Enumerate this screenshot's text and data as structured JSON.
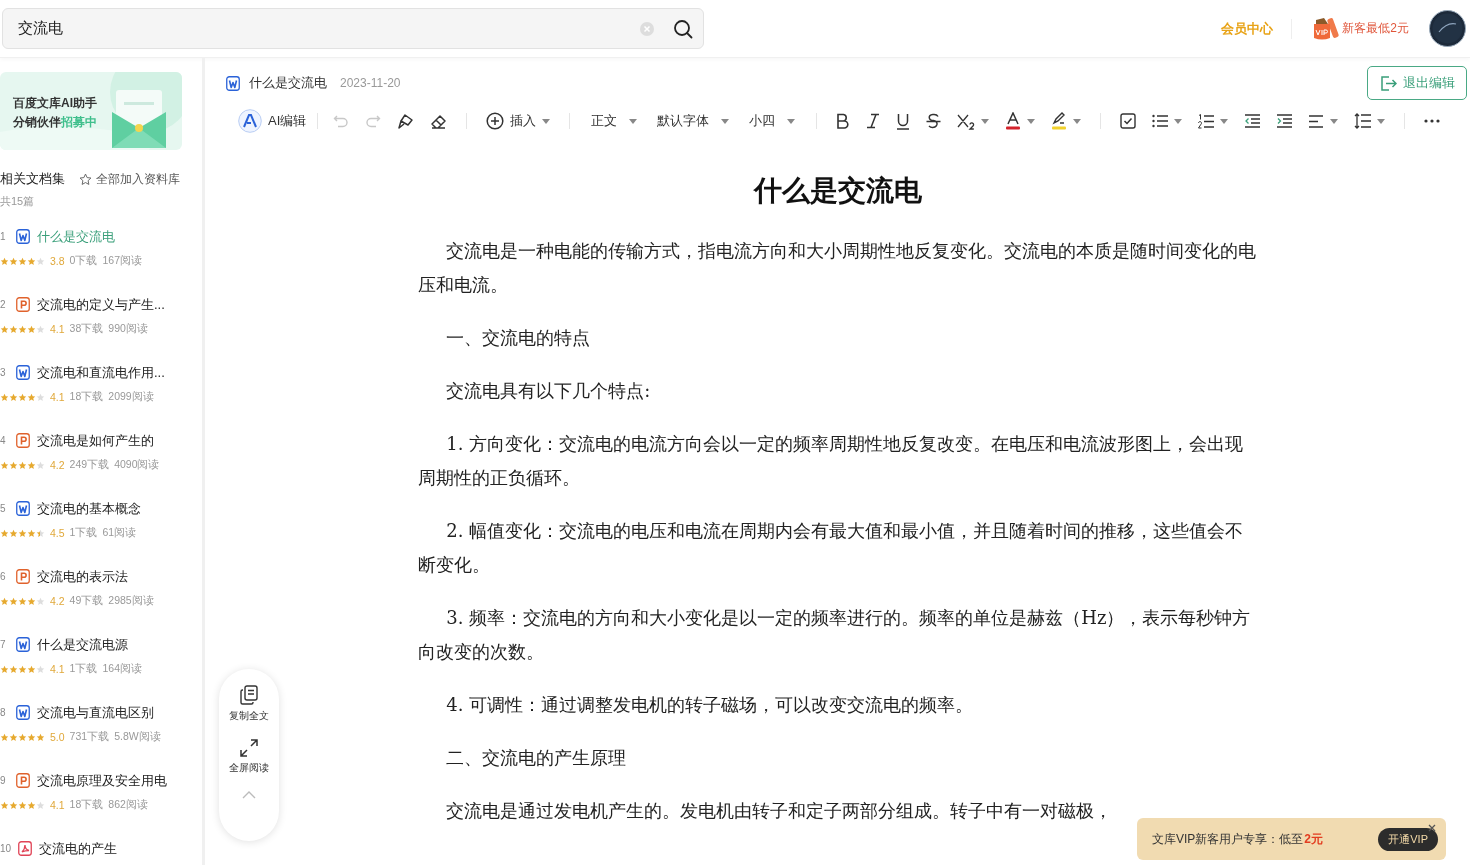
{
  "search": {
    "value": "交流电"
  },
  "header": {
    "member_center": "会员中心",
    "promo": "新客最低2元"
  },
  "sidebar": {
    "banner": {
      "line1": "百度文库AI助手",
      "line2": "分销伙伴",
      "line2_highlight": "招募中"
    },
    "collection": {
      "title": "相关文档集",
      "add_all": "全部加入资料库",
      "count": "共15篇"
    },
    "documents": [
      {
        "index": "1",
        "kind": "word",
        "title": "什么是交流电",
        "selected": true,
        "stars": 4,
        "rating": "3.8",
        "downloads": "0下载",
        "reads": "167阅读"
      },
      {
        "index": "2",
        "kind": "ppt",
        "title": "交流电的定义与产生...",
        "selected": false,
        "stars": 4,
        "rating": "4.1",
        "downloads": "38下载",
        "reads": "990阅读"
      },
      {
        "index": "3",
        "kind": "word",
        "title": "交流电和直流电作用...",
        "selected": false,
        "stars": 4,
        "rating": "4.1",
        "downloads": "18下载",
        "reads": "2099阅读"
      },
      {
        "index": "4",
        "kind": "ppt",
        "title": "交流电是如何产生的",
        "selected": false,
        "stars": 4,
        "rating": "4.2",
        "downloads": "249下载",
        "reads": "4090阅读"
      },
      {
        "index": "5",
        "kind": "word",
        "title": "交流电的基本概念",
        "selected": false,
        "stars": 4.5,
        "rating": "4.5",
        "downloads": "1下载",
        "reads": "61阅读"
      },
      {
        "index": "6",
        "kind": "ppt",
        "title": "交流电的表示法",
        "selected": false,
        "stars": 4,
        "rating": "4.2",
        "downloads": "49下载",
        "reads": "2985阅读"
      },
      {
        "index": "7",
        "kind": "word",
        "title": "什么是交流电源",
        "selected": false,
        "stars": 4,
        "rating": "4.1",
        "downloads": "1下载",
        "reads": "164阅读"
      },
      {
        "index": "8",
        "kind": "word",
        "title": "交流电与直流电区别",
        "selected": false,
        "stars": 5,
        "rating": "5.0",
        "downloads": "731下载",
        "reads": "5.8W阅读"
      },
      {
        "index": "9",
        "kind": "ppt",
        "title": "交流电原理及安全用电",
        "selected": false,
        "stars": 4,
        "rating": "4.1",
        "downloads": "18下载",
        "reads": "862阅读"
      },
      {
        "index": "10",
        "kind": "pdf",
        "title": "交流电的产生",
        "selected": false
      }
    ]
  },
  "document": {
    "title": "什么是交流电",
    "date": "2023-11-20",
    "exit_edit": "退出编辑",
    "toolbar": {
      "ai_edit": "AI编辑",
      "undo": {
        "disabled": true
      },
      "redo": {
        "disabled": true
      },
      "insert": "插入",
      "style": "正文",
      "font": "默认字体",
      "size": "小四"
    },
    "heading": "什么是交流电",
    "paragraphs": [
      "交流电是一种电能的传输方式，指电流方向和大小周期性地反复变化。交流电的本质是随时间变化的电压和电流。",
      "一、交流电的特点",
      "交流电具有以下几个特点:",
      "1. 方向变化：交流电的电流方向会以一定的频率周期性地反复改变。在电压和电流波形图上，会出现周期性的正负循环。",
      "2. 幅值变化：交流电的电压和电流在周期内会有最大值和最小值，并且随着时间的推移，这些值会不断变化。",
      "3. 频率：交流电的方向和大小变化是以一定的频率进行的。频率的单位是赫兹（Hz），表示每秒钟方向改变的次数。",
      "4. 可调性：通过调整发电机的转子磁场，可以改变交流电的频率。",
      "二、交流电的产生原理",
      "交流电是通过发电机产生的。发电机由转子和定子两部分组成。转子中有一对磁极，"
    ]
  },
  "side_tools": [
    {
      "label": "复制全文"
    },
    {
      "label": "全屏阅读"
    }
  ],
  "vip_banner": {
    "text": "文库VIP新客用户专享：低至",
    "price": "2元",
    "button": "开通VIP"
  }
}
